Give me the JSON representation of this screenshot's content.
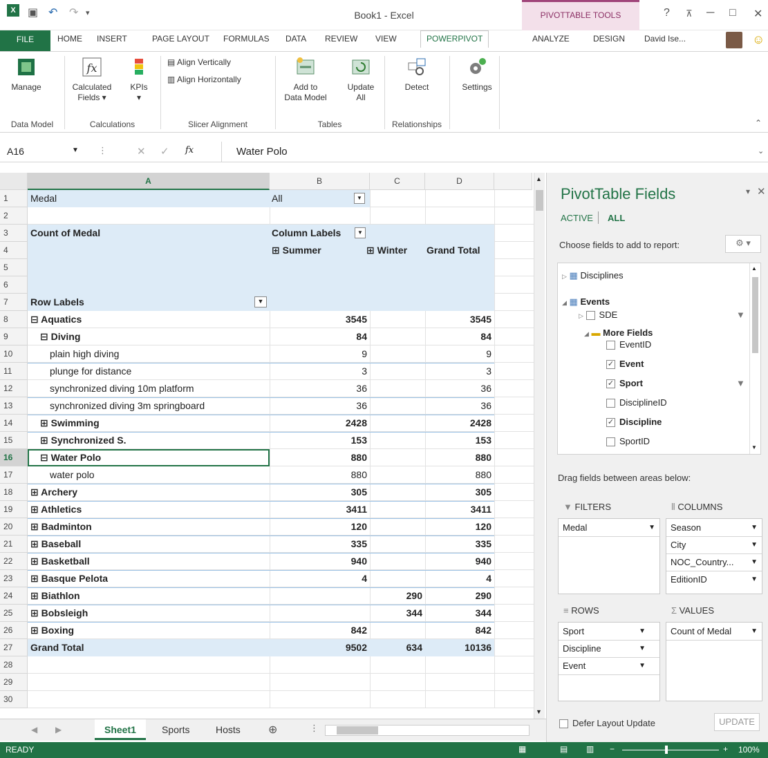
{
  "window": {
    "title": "Book1 - Excel",
    "context_tab_header": "PIVOTTABLE TOOLS",
    "user": "David Ise...",
    "help": "?"
  },
  "tabs": [
    "FILE",
    "HOME",
    "INSERT",
    "PAGE LAYOUT",
    "FORMULAS",
    "DATA",
    "REVIEW",
    "VIEW",
    "POWERPIVOT",
    "ANALYZE",
    "DESIGN"
  ],
  "ribbon": {
    "manage": "Manage",
    "calc_fields_1": "Calculated",
    "calc_fields_2": "Fields",
    "kpis": "KPIs",
    "align_v": "Align Vertically",
    "align_h": "Align Horizontally",
    "add_to_1": "Add to",
    "add_to_2": "Data Model",
    "update_1": "Update",
    "update_2": "All",
    "detect": "Detect",
    "settings": "Settings",
    "groups": [
      "Data Model",
      "Calculations",
      "Slicer Alignment",
      "Tables",
      "Relationships"
    ]
  },
  "formula_bar": {
    "name_box": "A16",
    "fx": "fx",
    "value": "Water Polo"
  },
  "grid": {
    "columns": [
      "A",
      "B",
      "C",
      "D"
    ],
    "filter_label": "Medal",
    "filter_value": "All",
    "values_label": "Count of Medal",
    "column_labels": "Column Labels",
    "col_summer": "Summer",
    "col_winter": "Winter",
    "col_grand": "Grand Total",
    "row_labels": "Row Labels",
    "rows": [
      {
        "label": "Aquatics",
        "b": "3545",
        "c": "",
        "d": "3545"
      },
      {
        "label": "Diving",
        "b": "84",
        "c": "",
        "d": "84"
      },
      {
        "label": "plain high diving",
        "b": "9",
        "c": "",
        "d": "9"
      },
      {
        "label": "plunge for distance",
        "b": "3",
        "c": "",
        "d": "3"
      },
      {
        "label": "synchronized diving 10m platform",
        "b": "36",
        "c": "",
        "d": "36"
      },
      {
        "label": "synchronized diving 3m springboard",
        "b": "36",
        "c": "",
        "d": "36"
      },
      {
        "label": "Swimming",
        "b": "2428",
        "c": "",
        "d": "2428"
      },
      {
        "label": "Synchronized S.",
        "b": "153",
        "c": "",
        "d": "153"
      },
      {
        "label": "Water Polo",
        "b": "880",
        "c": "",
        "d": "880"
      },
      {
        "label": "water polo",
        "b": "880",
        "c": "",
        "d": "880"
      },
      {
        "label": "Archery",
        "b": "305",
        "c": "",
        "d": "305"
      },
      {
        "label": "Athletics",
        "b": "3411",
        "c": "",
        "d": "3411"
      },
      {
        "label": "Badminton",
        "b": "120",
        "c": "",
        "d": "120"
      },
      {
        "label": "Baseball",
        "b": "335",
        "c": "",
        "d": "335"
      },
      {
        "label": "Basketball",
        "b": "940",
        "c": "",
        "d": "940"
      },
      {
        "label": "Basque Pelota",
        "b": "4",
        "c": "",
        "d": "4"
      },
      {
        "label": "Biathlon",
        "b": "",
        "c": "290",
        "d": "290"
      },
      {
        "label": "Bobsleigh",
        "b": "",
        "c": "344",
        "d": "344"
      },
      {
        "label": "Boxing",
        "b": "842",
        "c": "",
        "d": "842"
      },
      {
        "label": "Grand Total",
        "b": "9502",
        "c": "634",
        "d": "10136"
      }
    ]
  },
  "sheets": [
    "Sheet1",
    "Sports",
    "Hosts"
  ],
  "status": {
    "ready": "READY",
    "zoom": "100%"
  },
  "panel": {
    "title": "PivotTable Fields",
    "tab_active": "ACTIVE",
    "tab_all": "ALL",
    "choose": "Choose fields to add to report:",
    "fields": {
      "disciplines": "Disciplines",
      "events": "Events",
      "sde": "SDE",
      "more_fields": "More Fields",
      "eventid": "EventID",
      "event": "Event",
      "sport": "Sport",
      "disciplineid": "DisciplineID",
      "discipline": "Discipline",
      "sportid": "SportID"
    },
    "drag_hint": "Drag fields between areas below:",
    "filters_label": "FILTERS",
    "columns_label": "COLUMNS",
    "rows_label": "ROWS",
    "values_label": "VALUES",
    "filters": [
      "Medal"
    ],
    "columns": [
      "Season",
      "City",
      "NOC_Country...",
      "EditionID"
    ],
    "rows_items": [
      "Sport",
      "Discipline",
      "Event"
    ],
    "values": [
      "Count of Medal"
    ],
    "defer": "Defer Layout Update",
    "update": "UPDATE"
  }
}
